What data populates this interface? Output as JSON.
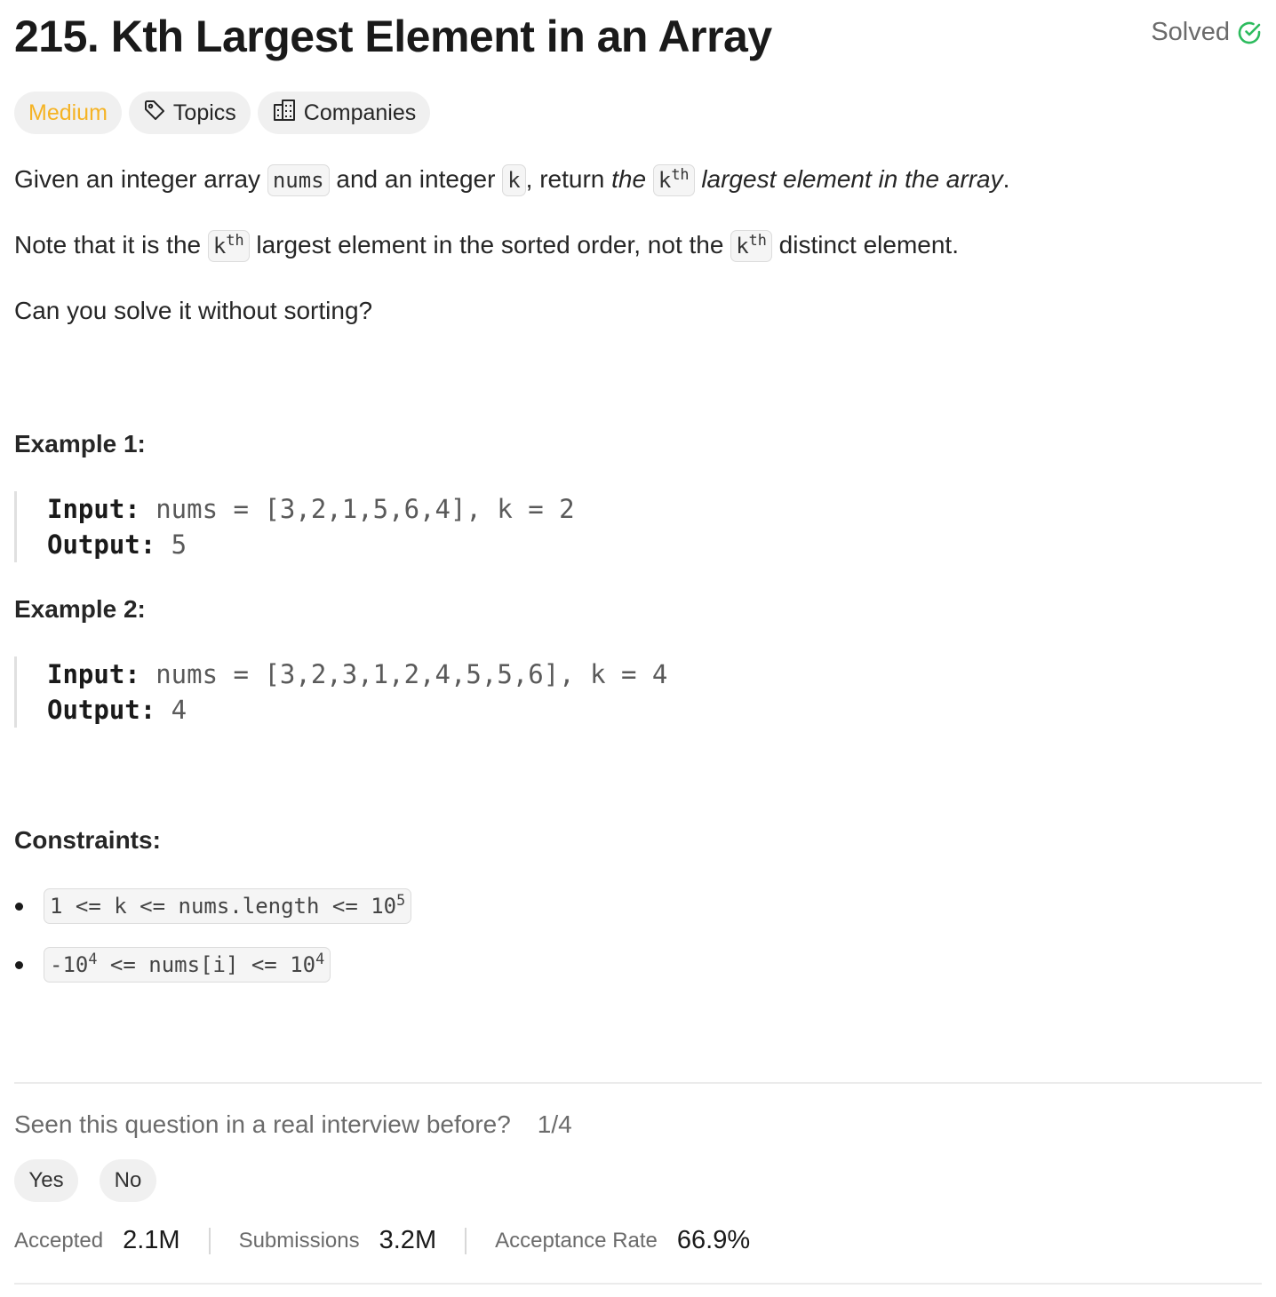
{
  "title": "215. Kth Largest Element in an Array",
  "status": {
    "label": "Solved",
    "color": "#2cbb5d",
    "icon": "check-circle-icon"
  },
  "tags": {
    "difficulty": "Medium",
    "difficulty_color": "#f5b324",
    "topics": "Topics",
    "topics_icon": "tag-icon",
    "companies": "Companies",
    "companies_icon": "building-icon"
  },
  "description": {
    "p1": {
      "t1": "Given an integer array ",
      "c1": "nums",
      "t2": " and an integer ",
      "c2": "k",
      "t3": ", return ",
      "i1": "the",
      "c3": "k",
      "c3sup": "th",
      "i2": "largest element in the array",
      "t4": "."
    },
    "p2": {
      "t1": "Note that it is the ",
      "c1": "k",
      "c1sup": "th",
      "t2": " largest element in the sorted order, not the ",
      "c2": "k",
      "c2sup": "th",
      "t3": " distinct element."
    },
    "p3": "Can you solve it without sorting?"
  },
  "examples": [
    {
      "heading": "Example 1:",
      "input_label": "Input:",
      "input": " nums = [3,2,1,5,6,4], k = 2",
      "output_label": "Output:",
      "output": " 5"
    },
    {
      "heading": "Example 2:",
      "input_label": "Input:",
      "input": " nums = [3,2,3,1,2,4,5,5,6], k = 4",
      "output_label": "Output:",
      "output": " 4"
    }
  ],
  "constraints": {
    "heading": "Constraints:",
    "items": [
      {
        "pre": "1 <= k <= nums.length <= 10",
        "sup": "5",
        "post": ""
      },
      {
        "pre": "-10",
        "sup": "4",
        "mid": " <= nums[i] <= 10",
        "sup2": "4"
      }
    ]
  },
  "interview": {
    "question": "Seen this question in a real interview before?",
    "count": "1/4",
    "yes": "Yes",
    "no": "No"
  },
  "stats": [
    {
      "label": "Accepted",
      "value": "2.1M"
    },
    {
      "label": "Submissions",
      "value": "3.2M"
    },
    {
      "label": "Acceptance Rate",
      "value": "66.9%"
    }
  ]
}
